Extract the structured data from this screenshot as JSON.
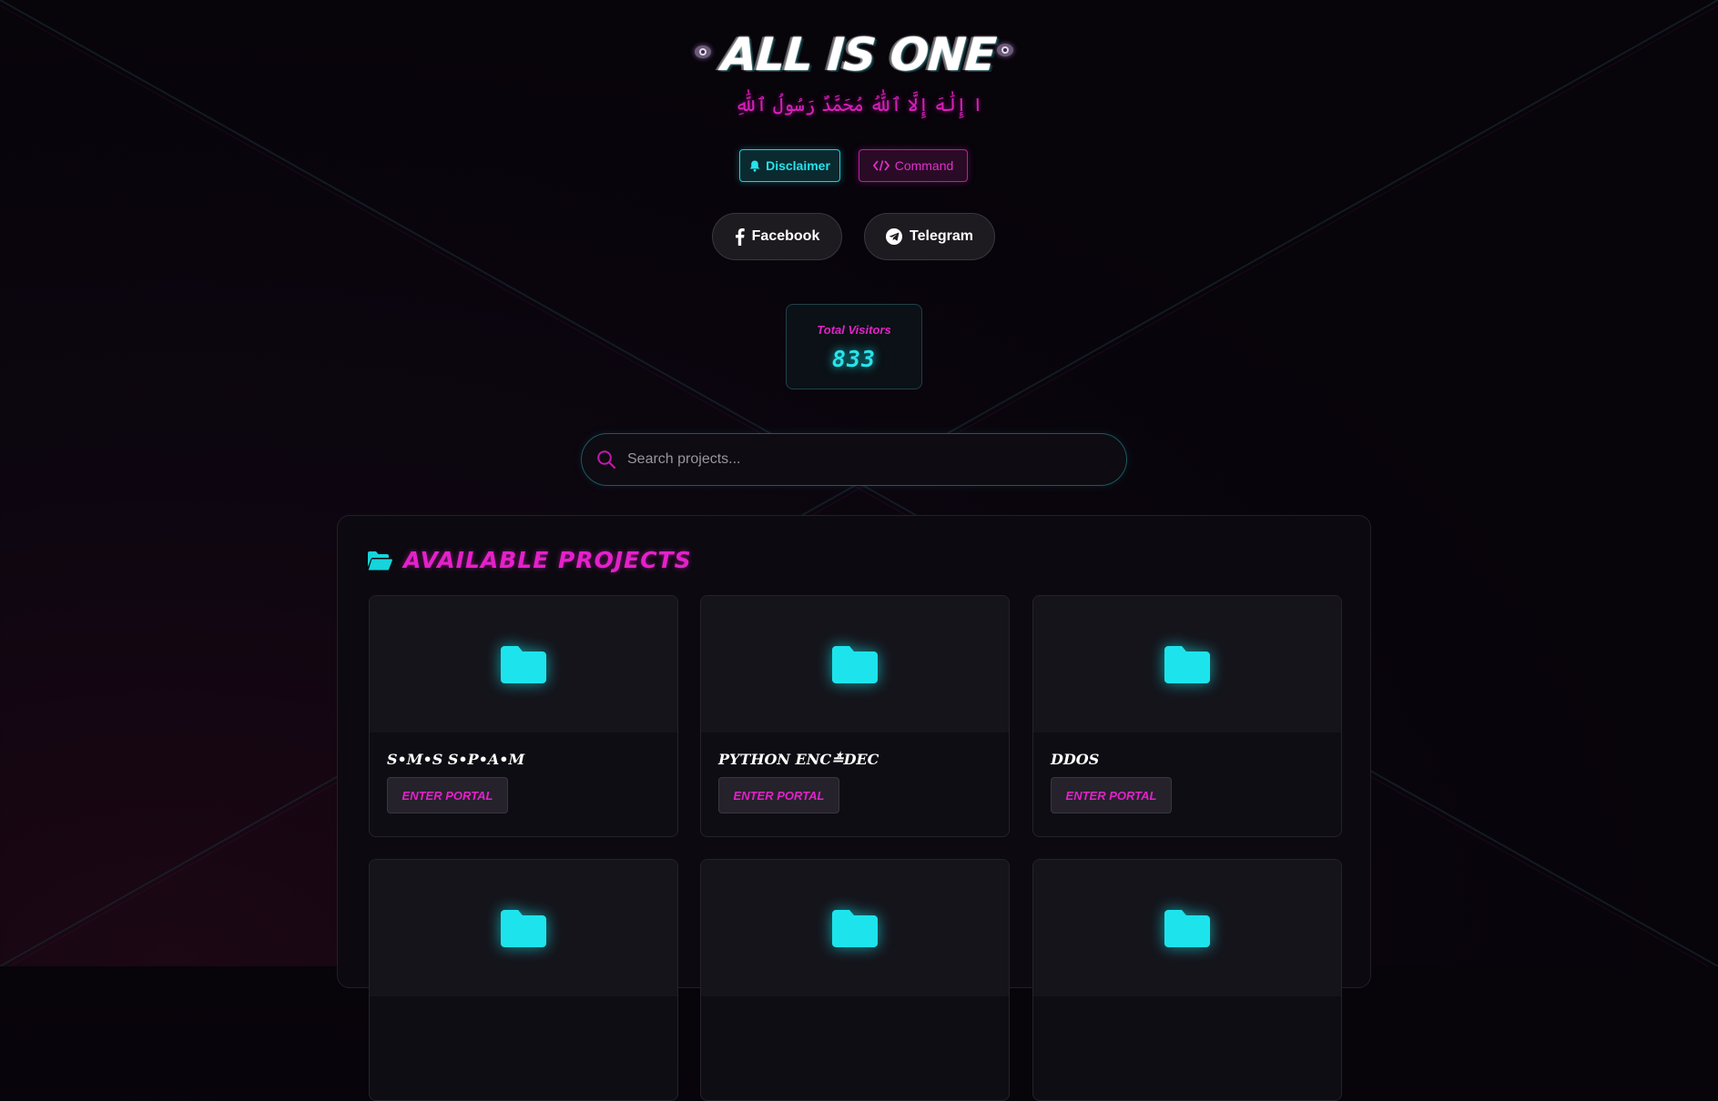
{
  "header": {
    "title": "ALL IS ONE",
    "subtitle": "ا إِلَٰهَ إِلَّا ٱللَّٰهُ مُحَمَّدٌ رَسُولُ ٱللَّٰهِ"
  },
  "actions": {
    "disclaimer_label": "Disclaimer",
    "command_label": "Command"
  },
  "social": {
    "facebook_label": "Facebook",
    "telegram_label": "Telegram"
  },
  "visitors": {
    "label": "Total Visitors",
    "count": "833"
  },
  "search": {
    "placeholder": "Search projects..."
  },
  "projects": {
    "title": "AVAILABLE PROJECTS",
    "items": [
      {
        "name": "S•M•S S•P•A•M",
        "button": "ENTER PORTAL"
      },
      {
        "name": "PYTHON ENC≛DEC",
        "button": "ENTER PORTAL"
      },
      {
        "name": "DDOS",
        "button": "ENTER PORTAL"
      },
      {
        "name": "",
        "button": ""
      },
      {
        "name": "",
        "button": ""
      },
      {
        "name": "",
        "button": ""
      }
    ]
  },
  "colors": {
    "accent_cyan": "#16d4dc",
    "accent_magenta": "#e421c9",
    "background": "#07040a"
  },
  "icons": [
    "bell-icon",
    "code-icon",
    "facebook-icon",
    "telegram-icon",
    "search-icon",
    "folder-open-icon",
    "folder-icon"
  ]
}
